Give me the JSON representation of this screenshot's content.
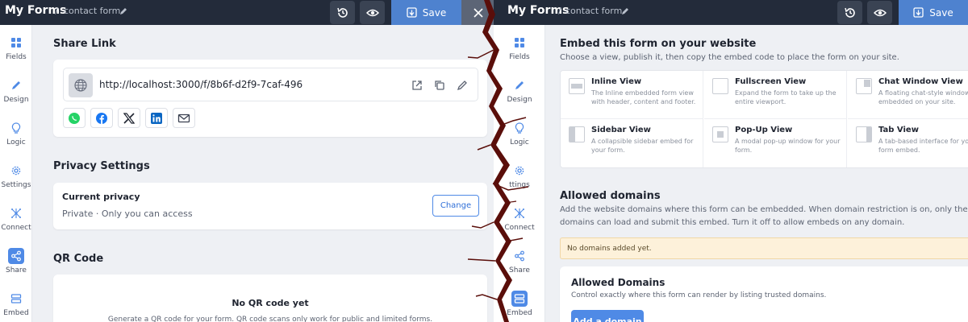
{
  "topbar": {
    "app_title": "My Forms",
    "separator": "/",
    "form_name": "contact form",
    "save_label": "Save"
  },
  "rail_left": [
    {
      "label": "Fields",
      "icon": "grid-icon",
      "active": false
    },
    {
      "label": "Design",
      "icon": "brush-icon",
      "active": false
    },
    {
      "label": "Logic",
      "icon": "bulb-icon",
      "active": false
    },
    {
      "label": "Settings",
      "icon": "gear-icon",
      "active": false
    },
    {
      "label": "Connect",
      "icon": "network-icon",
      "active": false
    },
    {
      "label": "Share",
      "icon": "share-icon",
      "active": true
    },
    {
      "label": "Embed",
      "icon": "embed-icon",
      "active": false
    }
  ],
  "rail_right": [
    {
      "label": "Fields",
      "icon": "grid-icon",
      "active": false
    },
    {
      "label": "Design",
      "icon": "brush-icon",
      "active": false
    },
    {
      "label": "Logic",
      "icon": "bulb-icon",
      "active": false
    },
    {
      "label": "ttings",
      "icon": "gear-icon",
      "active": false
    },
    {
      "label": "Connect",
      "icon": "network-icon",
      "active": false
    },
    {
      "label": "Share",
      "icon": "share-icon",
      "active": false
    },
    {
      "label": "Embed",
      "icon": "embed-icon",
      "active": true
    }
  ],
  "share": {
    "title": "Share Link",
    "url": "http://localhost:3000/f/8b6f-d2f9-7caf-496",
    "channels": [
      "whatsapp-icon",
      "facebook-icon",
      "x-icon",
      "linkedin-icon",
      "mail-icon"
    ]
  },
  "privacy": {
    "title": "Privacy Settings",
    "card_title": "Current privacy",
    "value": "Private · Only you can access",
    "change_label": "Change"
  },
  "qr": {
    "title": "QR Code",
    "empty_title": "No QR code yet",
    "empty_desc": "Generate a QR code for your form. QR code scans only work for public and limited forms."
  },
  "embed": {
    "title": "Embed this form on your website",
    "subtitle": "Choose a view, publish it, then copy the embed code to place the form on your site.",
    "views": [
      {
        "title": "Inline View",
        "desc": "The Inline embedded form view with header, content and footer.",
        "thumb": "inline"
      },
      {
        "title": "Fullscreen View",
        "desc": "Expand the form to take up the entire viewport.",
        "thumb": "fullscreen"
      },
      {
        "title": "Chat Window View",
        "desc": "A floating chat-style window embedded on your site.",
        "thumb": "chat"
      },
      {
        "title": "Sidebar View",
        "desc": "A collapsible sidebar embed for your form.",
        "thumb": "sidebar"
      },
      {
        "title": "Pop-Up View",
        "desc": "A modal pop-up window for your form.",
        "thumb": "popup"
      },
      {
        "title": "Tab View",
        "desc": "A tab-based interface for your form embed.",
        "thumb": "tab"
      }
    ]
  },
  "domains": {
    "title": "Allowed domains",
    "desc_line1": "Add the website domains where this form can be embedded. When domain restriction is on, only the listed",
    "desc_line2": "domains can load and submit this embed. Turn it off to allow embeds on any domain.",
    "notice": "No domains added yet.",
    "card_title": "Allowed Domains",
    "card_desc": "Control exactly where this form can render by listing trusted domains.",
    "add_label": "Add a domain"
  },
  "colors": {
    "topbar": "#232b3a",
    "accent": "#4f8ae6",
    "save": "#4e82cf",
    "crack": "#5a0e0a"
  }
}
